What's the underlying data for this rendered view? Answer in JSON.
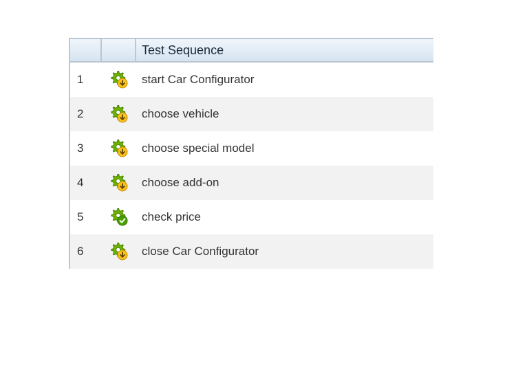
{
  "header": {
    "column_label": "Test Sequence"
  },
  "steps": [
    {
      "n": "1",
      "label": "start Car Configurator",
      "icon": "gear-run"
    },
    {
      "n": "2",
      "label": "choose vehicle",
      "icon": "gear-run"
    },
    {
      "n": "3",
      "label": "choose special model",
      "icon": "gear-run"
    },
    {
      "n": "4",
      "label": "choose add-on",
      "icon": "gear-run"
    },
    {
      "n": "5",
      "label": "check price",
      "icon": "gear-check"
    },
    {
      "n": "6",
      "label": "close Car Configurator",
      "icon": "gear-run"
    }
  ]
}
